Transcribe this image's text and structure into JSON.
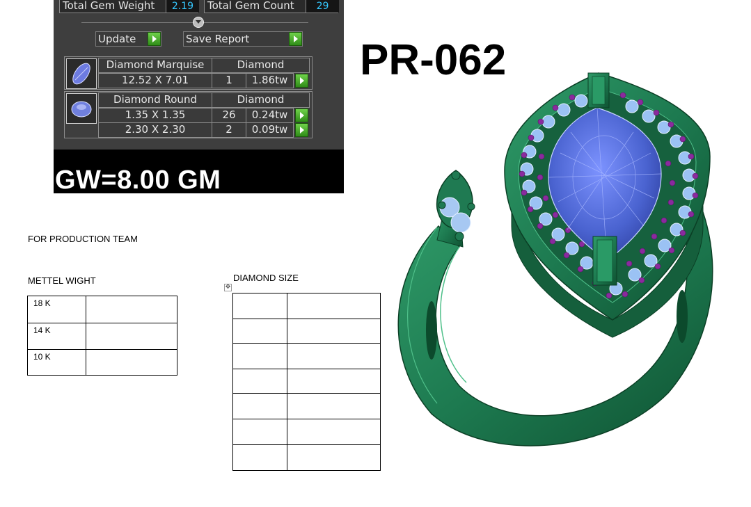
{
  "report": {
    "total_gem_weight_label": "Total Gem Weight",
    "total_gem_weight_value": "2.19",
    "total_gem_count_label": "Total Gem Count",
    "total_gem_count_value": "29",
    "update_label": "Update",
    "save_report_label": "Save Report",
    "gems": [
      {
        "name": "Diamond Marquise",
        "material": "Diamond",
        "rows": [
          {
            "size": "12.52 X 7.01",
            "count": "1",
            "weight": "1.86tw"
          }
        ]
      },
      {
        "name": "Diamond Round",
        "material": "Diamond",
        "rows": [
          {
            "size": "1.35 X 1.35",
            "count": "26",
            "weight": "0.24tw"
          },
          {
            "size": "2.30 X 2.30",
            "count": "2",
            "weight": "0.09tw"
          }
        ]
      }
    ],
    "gross_weight": "GW=8.00 GM"
  },
  "model_code": "PR-062",
  "production": {
    "heading": "FOR PRODUCTION TEAM",
    "metal_weight_heading": "METTEL WIGHT",
    "metal_rows": [
      "18 K",
      "14 K",
      "10 K"
    ],
    "diamond_size_heading": "DIAMOND SIZE",
    "move_handle_icon": "move-icon"
  },
  "colors": {
    "metal": "#1f7a52",
    "center_stone": "#4a63c8",
    "accent_gems": "#8a2a9e",
    "value_text": "#35c8ff"
  }
}
